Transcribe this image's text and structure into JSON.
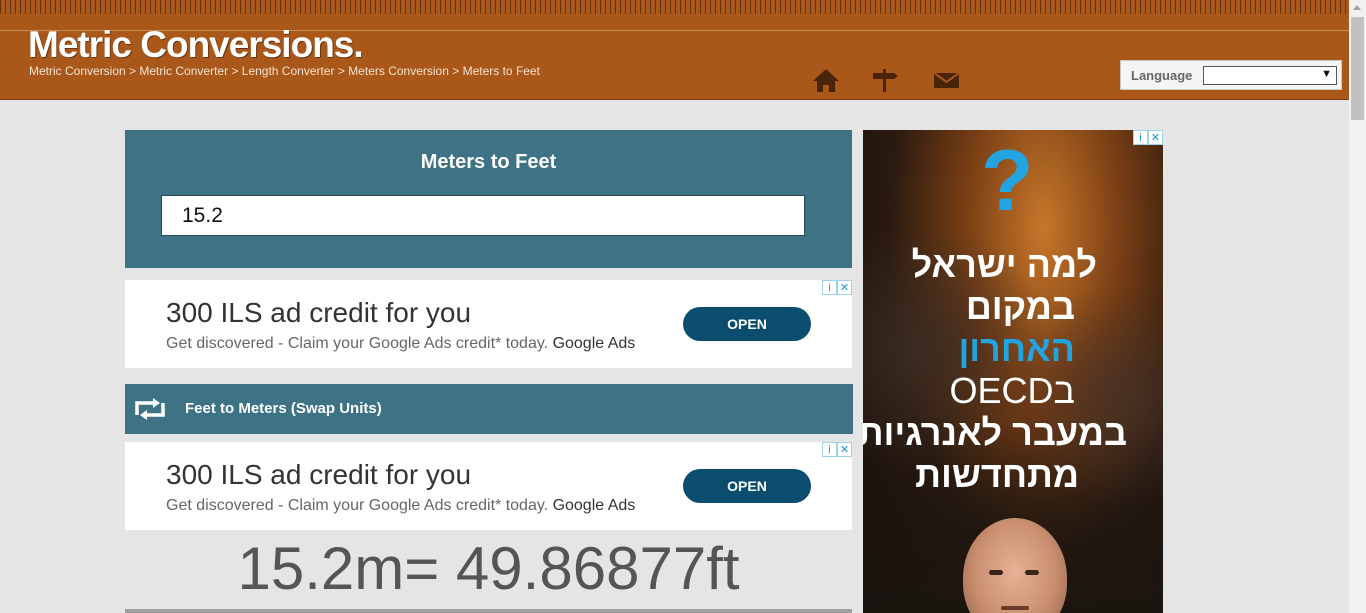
{
  "header": {
    "logo": "Metric Conversions.",
    "breadcrumb": [
      "Metric Conversion",
      "Metric Converter",
      "Length Converter",
      "Meters Conversion",
      "Meters to Feet"
    ],
    "breadcrumb_sep": " > ",
    "icons": [
      "home-icon",
      "signpost-icon",
      "mail-icon"
    ],
    "language_label": "Language",
    "language_value": ""
  },
  "converter": {
    "title": "Meters to Feet",
    "input_value": "15.2"
  },
  "ads": [
    {
      "headline": "300 ILS ad credit for you",
      "text": "Get discovered - Claim your Google Ads credit* today.",
      "brand": "Google Ads",
      "button": "OPEN"
    },
    {
      "headline": "300 ILS ad credit for you",
      "text": "Get discovered - Claim your Google Ads credit* today.",
      "brand": "Google Ads",
      "button": "OPEN"
    }
  ],
  "adchoices": {
    "info": "i",
    "close": "✕"
  },
  "swap": {
    "label": "Feet to Meters (Swap Units)"
  },
  "result": {
    "text": "15.2m= 49.86877ft"
  },
  "side_ad": {
    "qmark": "?",
    "lines": [
      "למה ישראל",
      "במקום",
      "האחרון",
      "בOECD",
      "במעבר לאנרגיות",
      "מתחדשות"
    ]
  },
  "colors": {
    "header": "#a9581a",
    "panel": "#3e7386",
    "button": "#0b4d6f",
    "accent": "#22a4e0"
  }
}
